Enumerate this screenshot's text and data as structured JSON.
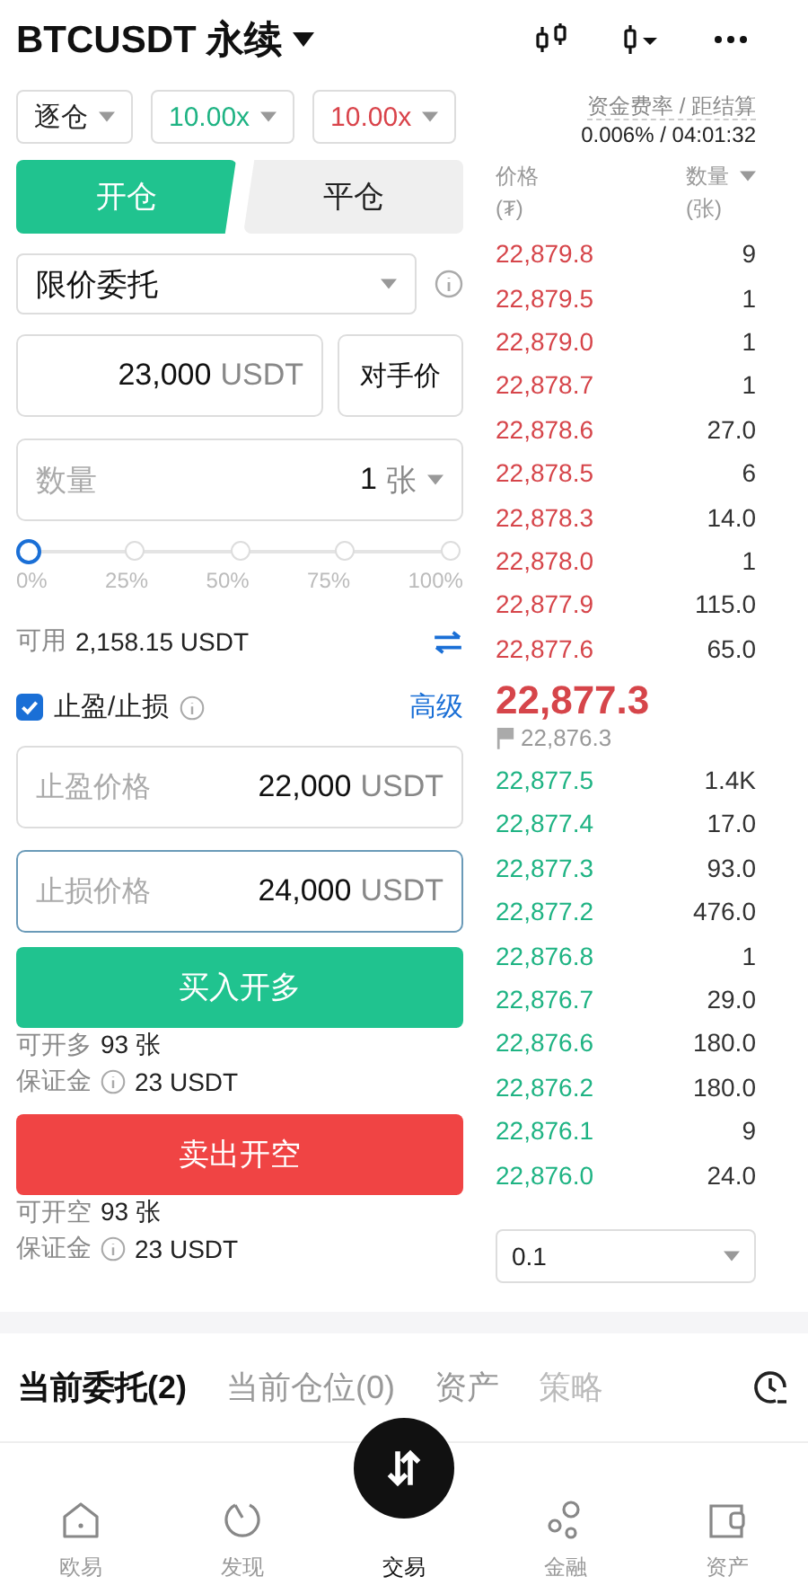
{
  "header": {
    "title": "BTCUSDT 永续"
  },
  "leverage": {
    "margin_mode": "逐仓",
    "long": "10.00x",
    "short": "10.00x"
  },
  "funding": {
    "label": "资金费率 / 距结算",
    "value": "0.006% / 04:01:32"
  },
  "tabs": [
    {
      "label": "开仓",
      "selected": true
    },
    {
      "label": "平仓",
      "selected": false
    }
  ],
  "order_type": "限价委托",
  "price_field": {
    "value": "23,000",
    "unit": "USDT",
    "button": "对手价"
  },
  "quantity_field": {
    "placeholder": "数量",
    "value": "1",
    "unit": "张"
  },
  "slider": {
    "level": 0,
    "ticks": [
      "0%",
      "25%",
      "50%",
      "75%",
      "100%"
    ]
  },
  "available": {
    "label": "可用",
    "value": "2,158.15 USDT"
  },
  "tpsl": {
    "checked": true,
    "label": "止盈/止损",
    "advanced": "高级"
  },
  "tp_sl_fields": [
    {
      "label": "止盈价格",
      "value": "22,000",
      "unit": "USDT",
      "focused": false
    },
    {
      "label": "止损价格",
      "value": "24,000",
      "unit": "USDT",
      "focused": true
    }
  ],
  "actions": [
    {
      "kind": "buy",
      "label": "买入开多",
      "max_label": "可开多",
      "max_value": "93 张",
      "margin_label": "保证金",
      "margin_value": "23 USDT"
    },
    {
      "kind": "sell",
      "label": "卖出开空",
      "max_label": "可开空",
      "max_value": "93 张",
      "margin_label": "保证金",
      "margin_value": "23 USDT"
    }
  ],
  "order_book": {
    "price_header": "价格",
    "price_unit": "(₮)",
    "qty_header": "数量",
    "qty_unit": "(张)",
    "asks": [
      {
        "price": "22,879.8",
        "qty": "9"
      },
      {
        "price": "22,879.5",
        "qty": "1"
      },
      {
        "price": "22,879.0",
        "qty": "1"
      },
      {
        "price": "22,878.7",
        "qty": "1"
      },
      {
        "price": "22,878.6",
        "qty": "27.0"
      },
      {
        "price": "22,878.5",
        "qty": "6"
      },
      {
        "price": "22,878.3",
        "qty": "14.0"
      },
      {
        "price": "22,878.0",
        "qty": "1"
      },
      {
        "price": "22,877.9",
        "qty": "115.0"
      },
      {
        "price": "22,877.6",
        "qty": "65.0"
      }
    ],
    "last_price": "22,877.3",
    "mark_price": "22,876.3",
    "bids": [
      {
        "price": "22,877.5",
        "qty": "1.4K"
      },
      {
        "price": "22,877.4",
        "qty": "17.0"
      },
      {
        "price": "22,877.3",
        "qty": "93.0"
      },
      {
        "price": "22,877.2",
        "qty": "476.0"
      },
      {
        "price": "22,876.8",
        "qty": "1"
      },
      {
        "price": "22,876.7",
        "qty": "29.0"
      },
      {
        "price": "22,876.6",
        "qty": "180.0"
      },
      {
        "price": "22,876.2",
        "qty": "180.0"
      },
      {
        "price": "22,876.1",
        "qty": "9"
      },
      {
        "price": "22,876.0",
        "qty": "24.0"
      }
    ],
    "precision": "0.1"
  },
  "bottom_tabs": [
    {
      "label": "当前委托(2)",
      "selected": true
    },
    {
      "label": "当前仓位(0)",
      "selected": false
    },
    {
      "label": "资产",
      "selected": false
    },
    {
      "label": "策略",
      "selected": false
    }
  ],
  "nav": [
    {
      "kind": "home",
      "label": "欧易",
      "selected": false
    },
    {
      "kind": "discover",
      "label": "发现",
      "selected": false
    },
    {
      "kind": "trade",
      "label": "交易",
      "selected": true
    },
    {
      "kind": "finance",
      "label": "金融",
      "selected": false
    },
    {
      "kind": "assets",
      "label": "资产",
      "selected": false
    }
  ]
}
